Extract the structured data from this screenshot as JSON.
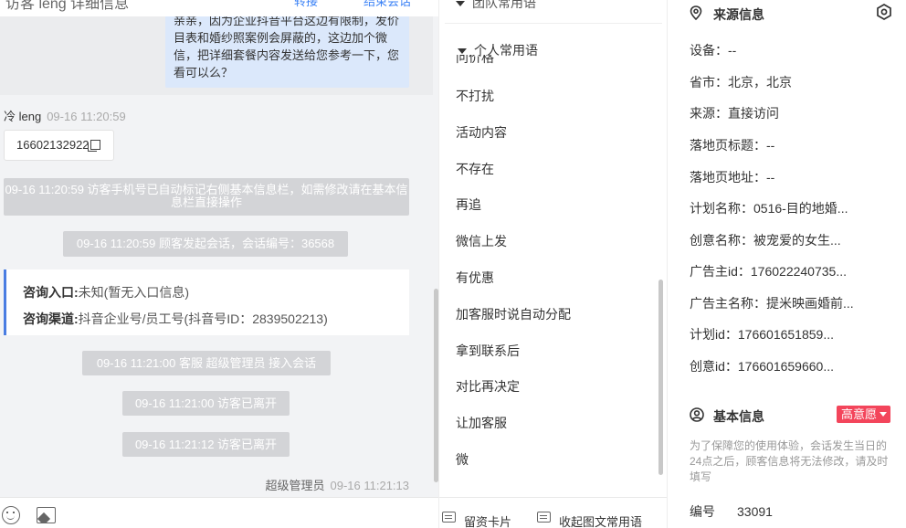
{
  "chat": {
    "top_title": "访客 leng 详细信息",
    "top_actions": [
      "转接",
      "结束会话"
    ],
    "visitor_message": "亲亲，因为企业抖音平台这边有限制，发价目表和婚纱照案例会屏蔽的，这边加个微信，把详细套餐内容发送给您参考一下，您看可以么？",
    "visitor_name": "冷 leng",
    "visitor_time": "09-16 11:20:59",
    "phone": "16602132922",
    "system_messages": [
      "09-16 11:20:59 访客手机号已自动标记右侧基本信息栏，如需修改请在基本信息栏直接操作",
      "09-16 11:20:59 顾客发起会话，会话编号：36568",
      "09-16 11:21:00 客服 超级管理员 接入会话",
      "09-16 11:21:00 访客已离开",
      "09-16 11:21:12 访客已离开"
    ],
    "consult": {
      "entry_label": "咨询入口:",
      "entry_value": "未知(暂无入口信息)",
      "channel_label": "咨询渠道:",
      "channel_value": "抖音企业号/员工号(抖音号ID：2839502213)"
    },
    "agent_name": "超级管理员",
    "agent_time": "09-16 11:21:13"
  },
  "phrases": {
    "top_section": "团队常用语",
    "section": "个人常用语",
    "clipped_item": "问价格",
    "items": [
      "不打扰",
      "活动内容",
      "不存在",
      "再追",
      "微信上发",
      "有优惠",
      "加客服时说自动分配",
      "拿到联系后",
      "对比再决定",
      "让加客服",
      "微"
    ],
    "bottom": {
      "card_label": "留资卡片",
      "collect_label": "收起图文常用语"
    }
  },
  "info": {
    "source_title": "来源信息",
    "rows": [
      "设备：--",
      "省市：北京，北京",
      "来源：直接访问",
      "落地页标题：--",
      "落地页地址：--",
      "计划名称：0516-目的地婚...",
      "创意名称：被宠爱的女生...",
      "广告主id：176022240735...",
      "广告主名称：提米映画婚前...",
      "计划id：176601651859...",
      "创意id：176601659660..."
    ],
    "basic_title": "基本信息",
    "intent_badge": "高意愿",
    "notice": "为了保障您的使用体验，会话发生当日的24点之后，顾客信息将无法修改，请及时填写",
    "code_label": "编号",
    "code_value": "33091"
  },
  "colors": {
    "bubble": "#dbe8fb",
    "system": "#d3d4d7",
    "accent": "#4a7de2",
    "badge": "#f3455b"
  }
}
